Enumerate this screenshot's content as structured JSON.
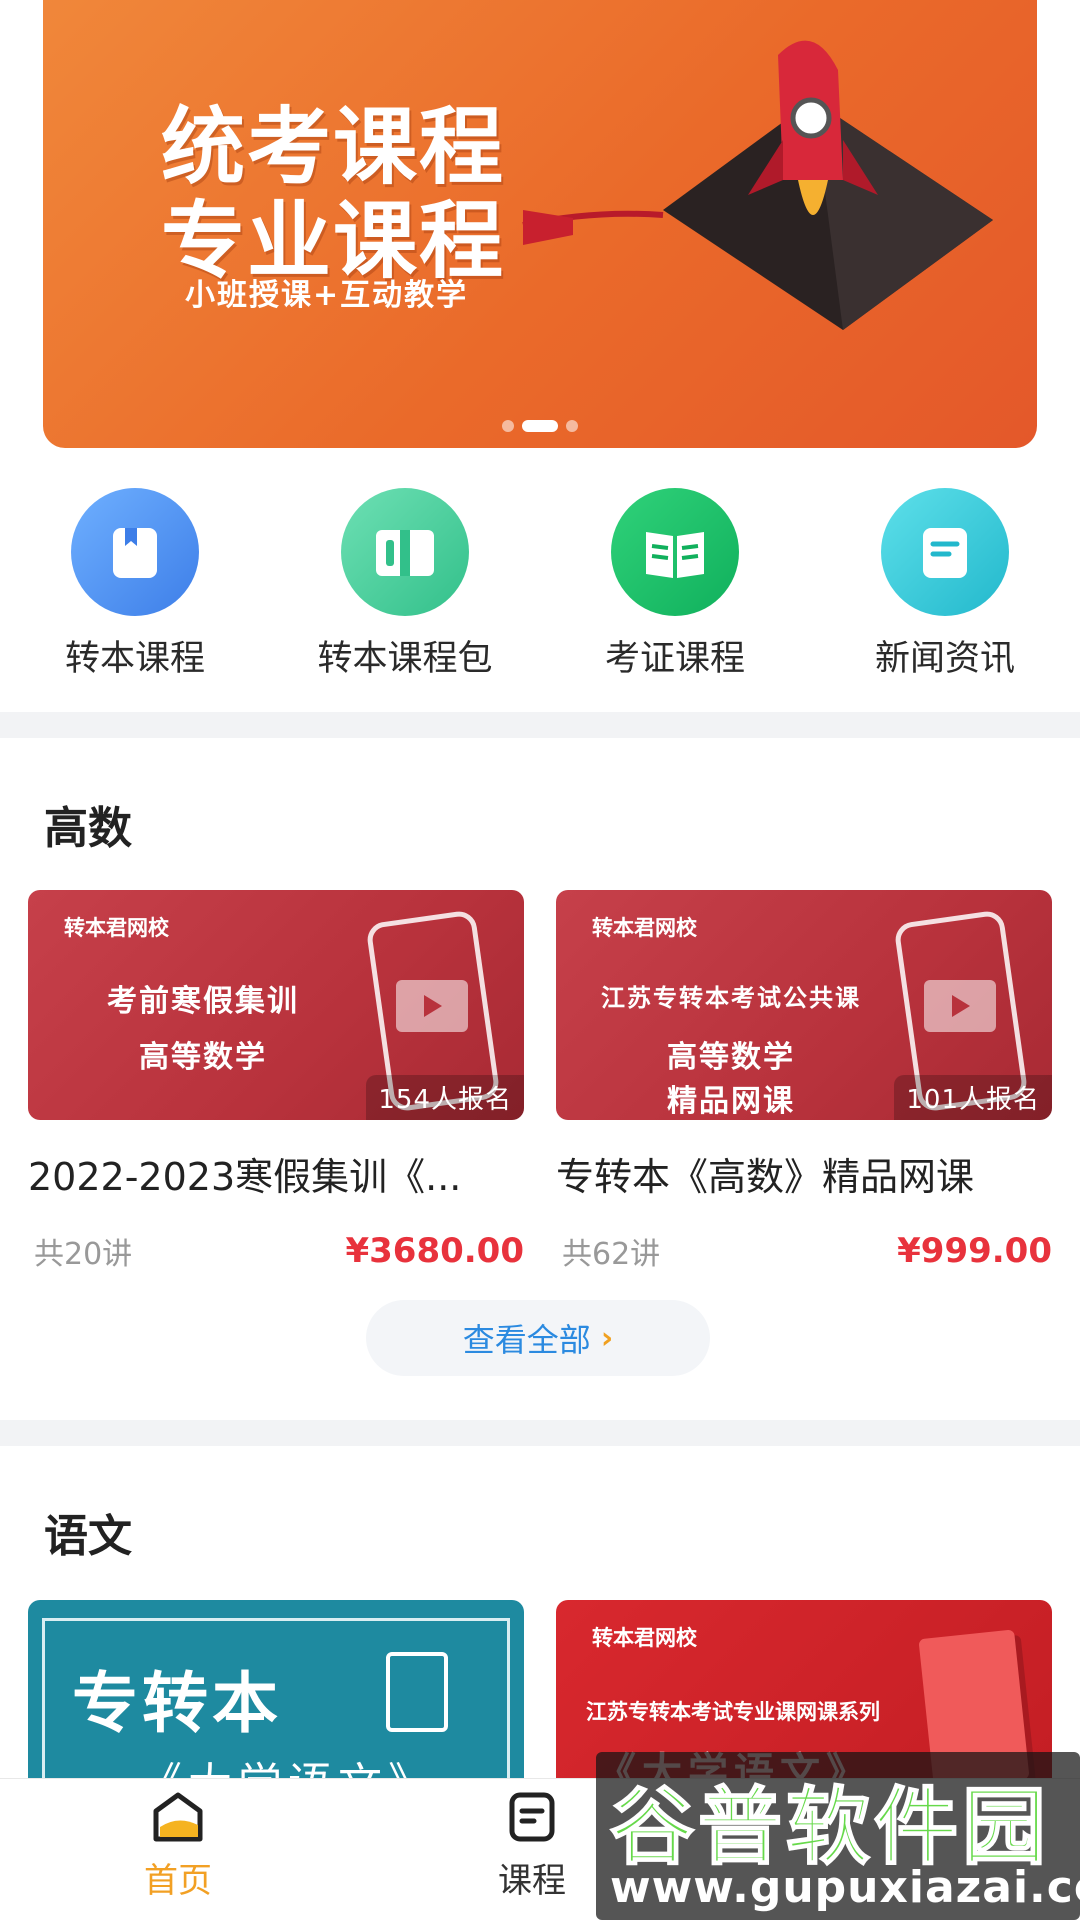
{
  "banner": {
    "title_line1": "统考课程",
    "title_line2": "专业课程",
    "subtitle": "小班授课+互动教学",
    "dots": 3,
    "active_dot": 1
  },
  "shortcuts": [
    {
      "label": "转本课程",
      "icon": "book-icon",
      "color": "#4a90f0"
    },
    {
      "label": "转本课程包",
      "icon": "open-book-icon",
      "color": "#3ccf96"
    },
    {
      "label": "考证课程",
      "icon": "textbook-icon",
      "color": "#18c06a"
    },
    {
      "label": "新闻资讯",
      "icon": "news-icon",
      "color": "#2ec8d8"
    }
  ],
  "section_math": {
    "title": "高数",
    "courses": [
      {
        "brand": "转本君网校",
        "thumb_line1": "考前寒假集训",
        "thumb_line2": "高等数学",
        "thumb_line3": "",
        "enroll": "154人报名",
        "title": "2022-2023寒假集训《...",
        "lessons": "共20讲",
        "price": "¥3680.00"
      },
      {
        "brand": "转本君网校",
        "thumb_line1": "江苏专转本考试公共课",
        "thumb_line2": "高等数学",
        "thumb_line3": "精品网课",
        "enroll": "101人报名",
        "title": "专转本《高数》精品网课",
        "lessons": "共62讲",
        "price": "¥999.00"
      }
    ],
    "view_all": "查看全部"
  },
  "section_chinese": {
    "title": "语文",
    "card1_line1": "专转本",
    "card1_line2": "《大学语文》",
    "card2_brand": "转本君网校",
    "card2_line1": "江苏专转本考试专业课网课系列",
    "card2_line2": "《大学语文》"
  },
  "tabbar": {
    "items": [
      {
        "label": "首页",
        "icon": "home-icon",
        "active": true
      },
      {
        "label": "课程",
        "icon": "course-icon",
        "active": false
      }
    ]
  },
  "watermark": {
    "text": "谷普软件园",
    "url": "www.gupuxiazai.com"
  }
}
